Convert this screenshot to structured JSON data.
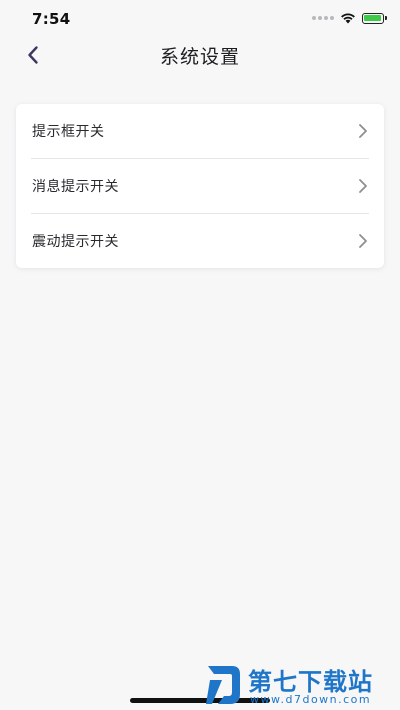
{
  "status_bar": {
    "time": "7:54"
  },
  "nav": {
    "title": "系统设置",
    "back_icon": "chevron-left-icon"
  },
  "settings": {
    "items": [
      {
        "label": "提示框开关",
        "icon": "chevron-right-icon"
      },
      {
        "label": "消息提示开关",
        "icon": "chevron-right-icon"
      },
      {
        "label": "震动提示开关",
        "icon": "chevron-right-icon"
      }
    ]
  },
  "watermark": {
    "title": "第七下载站",
    "url": "www.d7down.com"
  },
  "colors": {
    "background": "#f7f7f8",
    "card": "#ffffff",
    "chevron": "#8e8e93",
    "back_chevron": "#3b3760",
    "battery_fill": "#3fc94a",
    "watermark": "#1f76c9"
  }
}
